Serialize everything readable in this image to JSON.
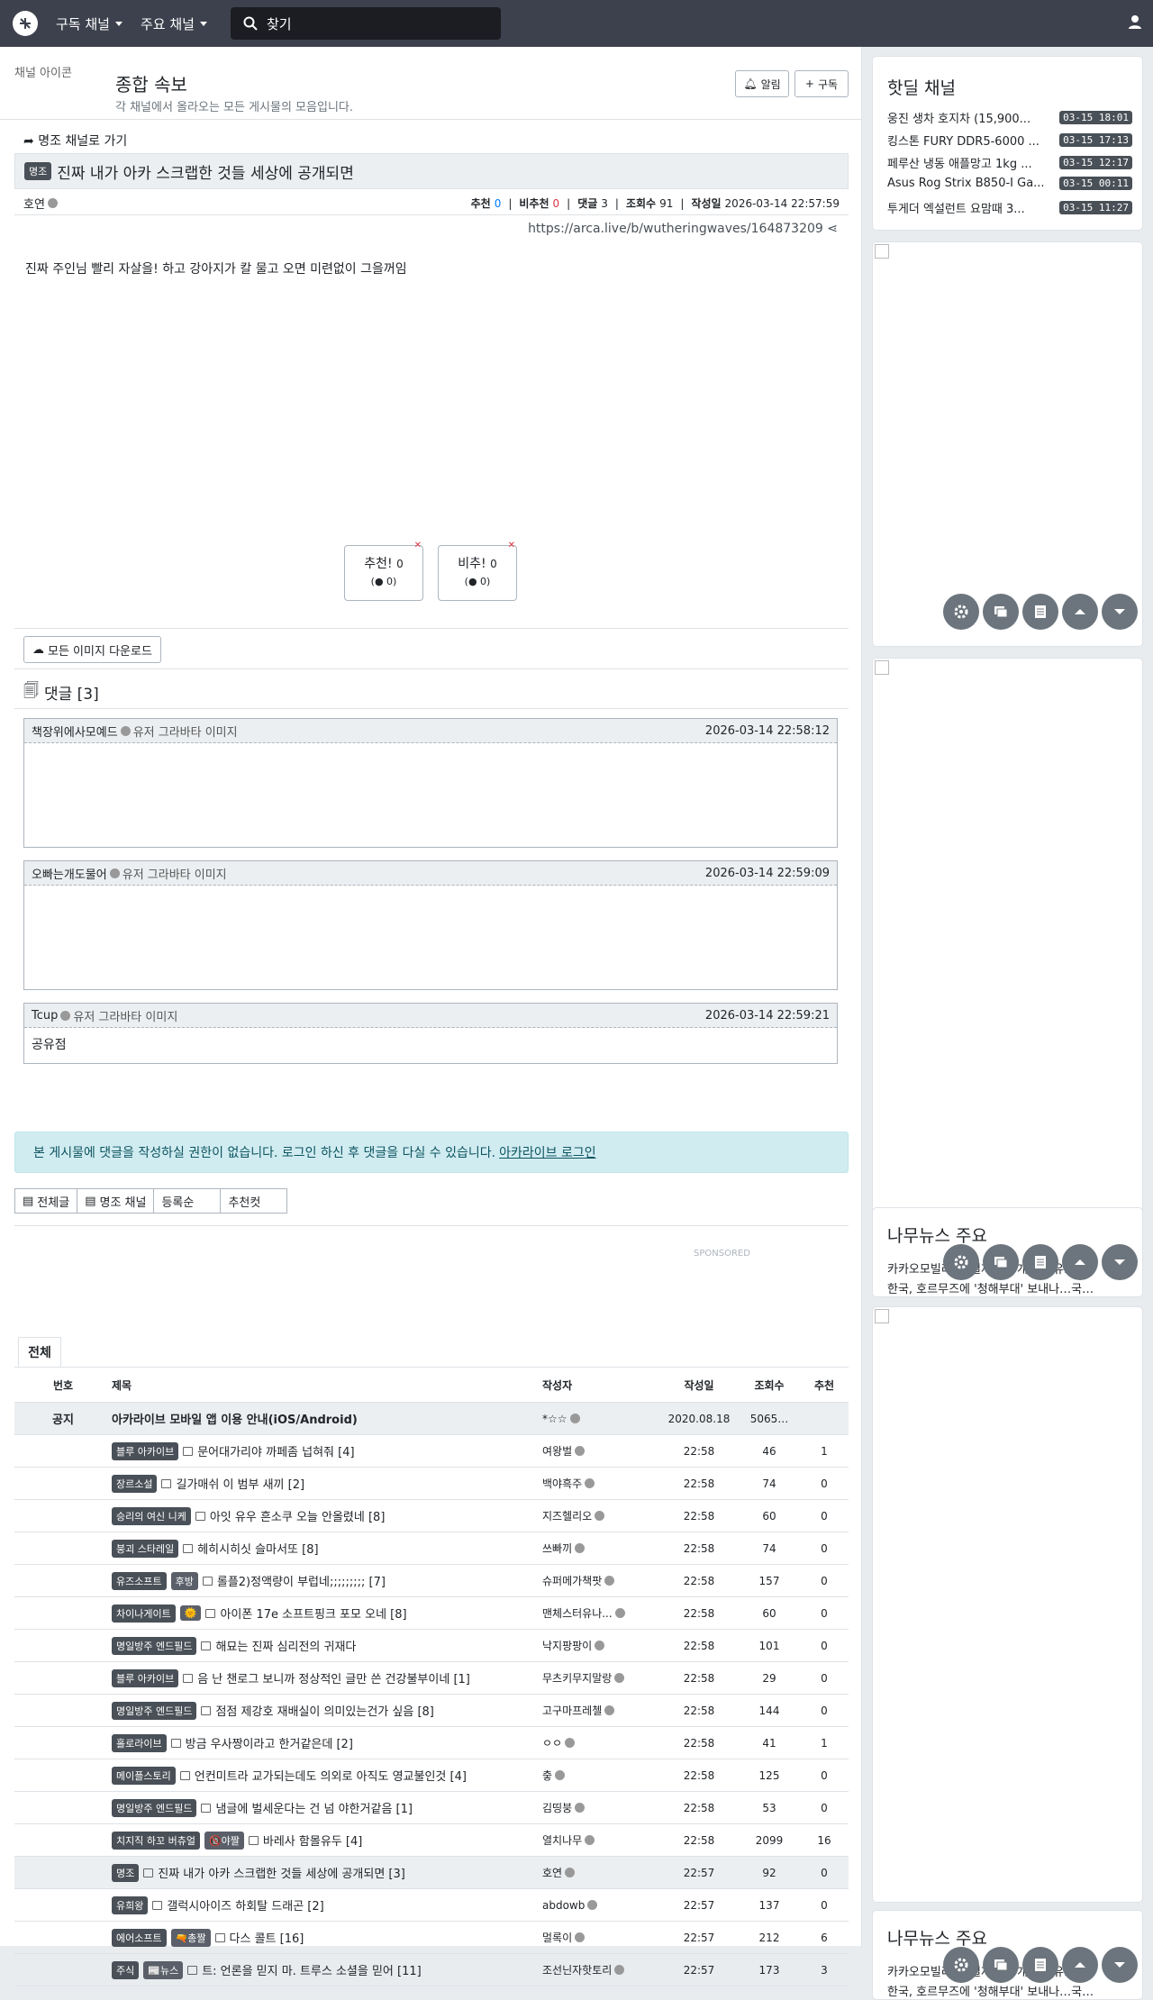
{
  "nav": {
    "subscribed_label": "구독 채널",
    "featured_label": "주요 채널",
    "search_placeholder": "찾기"
  },
  "channel": {
    "icon_alt": "채널 아이콘",
    "title": "종합 속보",
    "description": "각 채널에서 올라오는 모든 게시물의 모음입니다.",
    "alert_label": "알림",
    "subscribe_label": "구독"
  },
  "article": {
    "back_label": "명조 채널로 가기",
    "category": "명조",
    "title": "진짜 내가 아카 스크랩한 것들 세상에 공개되면",
    "author": "호연",
    "recommend_label": "추천",
    "recommend": "0",
    "unrecommend_label": "비추천",
    "unrecommend": "0",
    "comments_label": "댓글",
    "comments": "3",
    "views_label": "조회수",
    "views": "91",
    "date_label": "작성일",
    "date": "2026-03-14 22:57:59",
    "url": "https://arca.live/b/wutheringwaves/164873209",
    "body": "진짜 주인님 빨리 자살을! 하고 강아지가 칼 물고 오면 미련없이 그을꺼임",
    "vote_up_label": "추천!",
    "vote_up_count": "0",
    "vote_up_sub": "0",
    "vote_down_label": "비추!",
    "vote_down_count": "0",
    "vote_down_sub": "0",
    "download_label": "모든 이미지 다운로드"
  },
  "comments": {
    "header": "댓글 [3]",
    "avatar_alt": "유저 그라바타 이미지",
    "items": [
      {
        "author": "책장위에사모예드",
        "date": "2026-03-14 22:58:12",
        "text": ""
      },
      {
        "author": "오빠는개도물어",
        "date": "2026-03-14 22:59:09",
        "text": ""
      },
      {
        "author": "Tcup",
        "date": "2026-03-14 22:59:21",
        "text": "공유점"
      }
    ]
  },
  "login_alert": {
    "text": "본 게시물에 댓글을 작성하실 권한이 없습니다. 로그인 하신 후 댓글을 다실 수 있습니다.",
    "link": "아카라이브 로그인"
  },
  "list_buttons": [
    "전체글",
    "명조 채널",
    "등록순",
    "추천컷"
  ],
  "sponsored": "SPONSORED",
  "board": {
    "tab": "전체",
    "columns": [
      "번호",
      "제목",
      "작성자",
      "작성일",
      "조회수",
      "추천"
    ],
    "notice": {
      "no": "공지",
      "title": "아카라이브 모바일 앱 이용 안내(iOS/Android)",
      "author": "*☆☆",
      "date": "2020.08.18",
      "views": "5065…",
      "rec": ""
    },
    "rows": [
      {
        "cat": "블루 아카이브",
        "tag": "",
        "title": "문어대가리야 까페좀 넙혀줘 [4]",
        "author": "여왕벌",
        "date": "22:58",
        "views": "46",
        "rec": "1"
      },
      {
        "cat": "장르소설",
        "tag": "",
        "title": "길가매쉬 이 범부 새끼 [2]",
        "author": "백야흑주",
        "date": "22:58",
        "views": "74",
        "rec": "0"
      },
      {
        "cat": "승리의 여신 니케",
        "tag": "",
        "title": "아잇 유우 흔소쿠 오늘 안올렸네 [8]",
        "author": "지즈헬리오",
        "date": "22:58",
        "views": "60",
        "rec": "0"
      },
      {
        "cat": "붕괴 스타레일",
        "tag": "",
        "title": "헤히시히싯 슬마서또 [8]",
        "author": "쓰빠끼",
        "date": "22:58",
        "views": "74",
        "rec": "0"
      },
      {
        "cat": "유즈소프트",
        "tag": "후방",
        "title": "롤플2)정액량이 부럽네;;;;;;;;; [7]",
        "author": "슈퍼메가책팟",
        "date": "22:58",
        "views": "157",
        "rec": "0"
      },
      {
        "cat": "차이나게이트",
        "tag": "🌞",
        "title": "아이폰 17e 소프트핑크 포모 오네 [8]",
        "author": "맨체스터유나...",
        "date": "22:58",
        "views": "60",
        "rec": "0"
      },
      {
        "cat": "명일방주 엔드필드",
        "tag": "",
        "title": "해묘는 진짜 심리전의 귀재다",
        "author": "낙지팡팡이",
        "date": "22:58",
        "views": "101",
        "rec": "0"
      },
      {
        "cat": "블루 아카이브",
        "tag": "",
        "title": "음 난 챈로그 보니까 정상적인 글만 쓴 건강불부이네 [1]",
        "author": "무츠키무지말랑",
        "date": "22:58",
        "views": "29",
        "rec": "0"
      },
      {
        "cat": "명일방주 엔드필드",
        "tag": "",
        "title": "점점 제강호 재배실이 의미있는건가 싶음 [8]",
        "author": "고구마프레첼",
        "date": "22:58",
        "views": "144",
        "rec": "0"
      },
      {
        "cat": "홀로라이브",
        "tag": "",
        "title": "방금 우사짱이라고 한거같은데 [2]",
        "author": "ㅇㅇ",
        "date": "22:58",
        "views": "41",
        "rec": "1"
      },
      {
        "cat": "메이플스토리",
        "tag": "",
        "title": "언컨미트라 교가되는데도 의외로 아직도 영교불인것 [4]",
        "author": "춯",
        "date": "22:58",
        "views": "125",
        "rec": "0"
      },
      {
        "cat": "명일방주 엔드필드",
        "tag": "",
        "title": "냄글에 벌세운다는 건 넘 야한거같음 [1]",
        "author": "김띵붕",
        "date": "22:58",
        "views": "53",
        "rec": "0"
      },
      {
        "cat": "치지직 하꼬 버츄얼",
        "tag": "🔞야짤",
        "title": "바레사 함몰유두 [4]",
        "author": "열치나무",
        "date": "22:58",
        "views": "2099",
        "rec": "16"
      },
      {
        "cat": "명조",
        "tag": "",
        "title": "진짜 내가 아카 스크랩한 것들 세상에 공개되면 [3]",
        "author": "호연",
        "date": "22:57",
        "views": "92",
        "rec": "0",
        "highlight": true
      },
      {
        "cat": "유희왕",
        "tag": "",
        "title": "갤럭시아이즈 하회탈 드래곤 [2]",
        "author": "abdowb",
        "date": "22:57",
        "views": "137",
        "rec": "0"
      },
      {
        "cat": "에어소프트",
        "tag": "🔫총짤",
        "title": "다스 콜트 [16]",
        "author": "멀록이",
        "date": "22:57",
        "views": "212",
        "rec": "6"
      },
      {
        "cat": "주식",
        "tag": "📰뉴스",
        "title": "트: 언론을 믿지 마. 트루스 소셜을 믿어 [11]",
        "author": "조선닌자핫토리",
        "date": "22:57",
        "views": "173",
        "rec": "3"
      }
    ]
  },
  "hot_deals": {
    "title": "핫딜 채널",
    "items": [
      {
        "title": "웅진 생차 호지차 (15,900...",
        "date": "03-15 18:01"
      },
      {
        "title": "킹스톤 FURY DDR5-6000 ...",
        "date": "03-15 17:13"
      },
      {
        "title": "페루산 냉동 애플망고 1kg ...",
        "date": "03-15 12:17"
      },
      {
        "title": "Asus Rog Strix B850-I Ga...",
        "date": "03-15 00:11"
      },
      {
        "title": "투게더 엑설런트 요맘때 3...",
        "date": "03-15 11:27"
      }
    ]
  },
  "news": {
    "title": "나무뉴스 주요",
    "line1": "카카오모빌리티, 결제사업 개편 사유…",
    "line2": "한국, 호르무즈에 '청해부대' 보내나…국…"
  }
}
